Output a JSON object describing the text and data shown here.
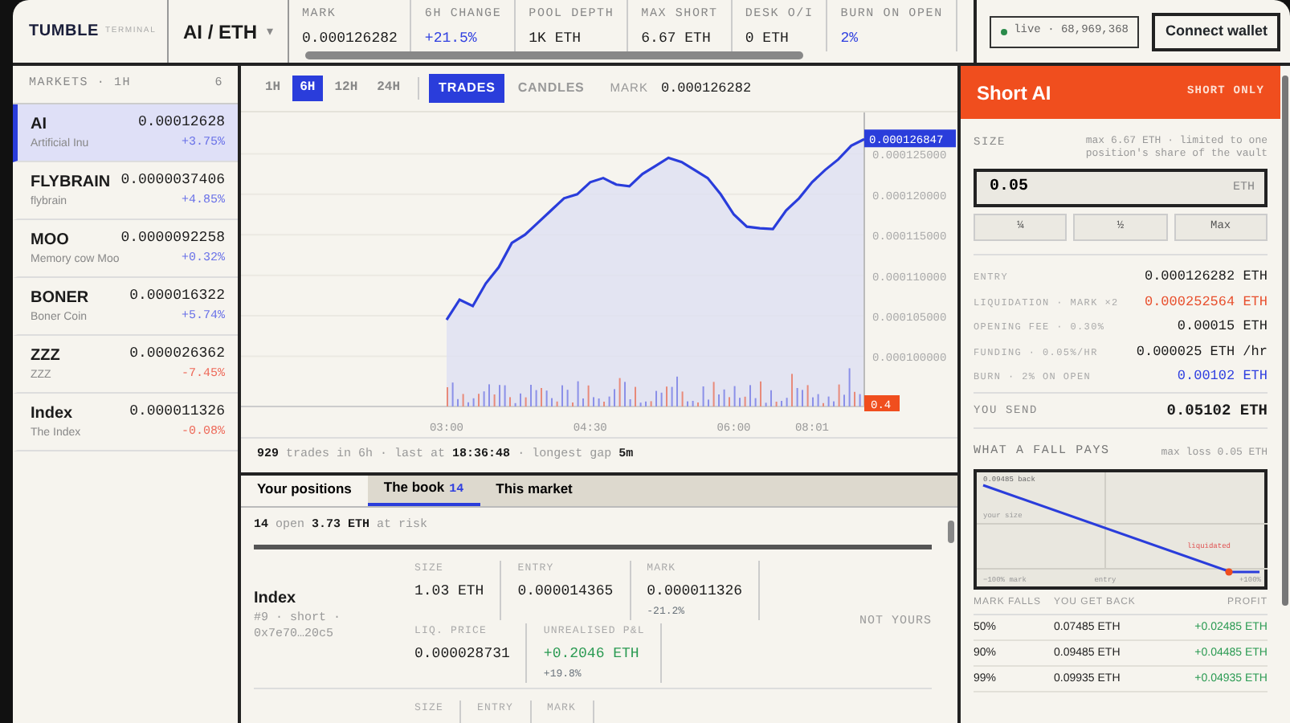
{
  "brand": {
    "name": "TUMBLE",
    "sub": "TERMINAL"
  },
  "pair": {
    "label": "AI / ETH",
    "caret": "▾"
  },
  "stats": [
    {
      "label": "MARK",
      "value": "0.000126282",
      "accent": false
    },
    {
      "label": "6H CHANGE",
      "value": "+21.5%",
      "accent": true
    },
    {
      "label": "POOL DEPTH",
      "value": "1K ETH",
      "accent": false
    },
    {
      "label": "MAX SHORT",
      "value": "6.67 ETH",
      "accent": false
    },
    {
      "label": "DESK O/I",
      "value": "0 ETH",
      "accent": false
    },
    {
      "label": "BURN ON OPEN",
      "value": "2%",
      "accent": true
    }
  ],
  "live": "live · 68,969,368",
  "connect_button": "Connect wallet",
  "markets": {
    "title": "MARKETS · 1H",
    "count": "6",
    "items": [
      {
        "symbol": "AI",
        "name": "Artificial Inu",
        "price": "0.00012628",
        "change": "+3.75%",
        "color": "#6a72e8",
        "selected": true
      },
      {
        "symbol": "FLYBRAIN",
        "name": "flybrain",
        "price": "0.0000037406",
        "change": "+4.85%",
        "color": "#6a72e8",
        "selected": false
      },
      {
        "symbol": "MOO",
        "name": "Memory cow Moo",
        "price": "0.0000092258",
        "change": "+0.32%",
        "color": "#6a72e8",
        "selected": false
      },
      {
        "symbol": "BONER",
        "name": "Boner Coin",
        "price": "0.000016322",
        "change": "+5.74%",
        "color": "#6a72e8",
        "selected": false
      },
      {
        "symbol": "ZZZ",
        "name": "ZZZ",
        "price": "0.000026362",
        "change": "-7.45%",
        "color": "#ee6a5a",
        "selected": false
      },
      {
        "symbol": "Index",
        "name": "The Index",
        "price": "0.000011326",
        "change": "-0.08%",
        "color": "#ee6a5a",
        "selected": false
      }
    ]
  },
  "timeframes": [
    {
      "label": "1H",
      "selected": false
    },
    {
      "label": "6H",
      "selected": true
    },
    {
      "label": "12H",
      "selected": false
    },
    {
      "label": "24H",
      "selected": false
    }
  ],
  "views": [
    {
      "label": "TRADES",
      "selected": true
    },
    {
      "label": "CANDLES",
      "selected": false
    }
  ],
  "mark": {
    "label": "MARK",
    "value": "0.000126282"
  },
  "chart": {
    "price_tag": "0.000126847",
    "volume_tag": "0.4",
    "chart_data": {
      "type": "area",
      "grid": true,
      "categories": [
        "03:00",
        null,
        null,
        null,
        null,
        null,
        null,
        null,
        null,
        null,
        null,
        "04:30",
        null,
        null,
        null,
        null,
        null,
        null,
        null,
        null,
        null,
        null,
        "06:00",
        null,
        null,
        null,
        null,
        null,
        "08:01",
        null,
        null,
        null,
        null
      ],
      "series": [
        {
          "color": "#2a3ddb",
          "values": [
            0.0001045,
            0.000107,
            0.0001062,
            0.000109,
            0.000111,
            0.000114,
            0.000115,
            0.0001165,
            0.000118,
            0.0001195,
            0.00012,
            0.0001215,
            0.000122,
            0.0001212,
            0.000121,
            0.0001225,
            0.0001235,
            0.0001245,
            0.000124,
            0.000123,
            0.000122,
            0.00012,
            0.0001175,
            0.000116,
            0.0001158,
            0.0001157,
            0.000118,
            0.0001195,
            0.0001215,
            0.000123,
            0.0001243,
            0.000126,
            0.0001268
          ]
        }
      ],
      "ylim": [
        9.38e-05,
        0.0001301
      ],
      "yticks": [
        {
          "value": 0.0001,
          "label": "0.000100000"
        },
        {
          "value": 0.000105,
          "label": "0.000105000"
        },
        {
          "value": 0.00011,
          "label": "0.000110000"
        },
        {
          "value": 0.000115,
          "label": "0.000115000"
        },
        {
          "value": 0.00012,
          "label": "0.000120000"
        },
        {
          "value": 0.000125,
          "label": "0.000125000"
        }
      ]
    }
  },
  "trade_info": "**929** trades in 6h · last at **18:36:48** · longest gap **5m**",
  "bottom_tabs": [
    {
      "label": "Your positions",
      "selected": false
    },
    {
      "label": "The book",
      "badge": "14",
      "selected": true
    },
    {
      "label": "This market",
      "selected": false
    }
  ],
  "book_summary": "**14** open  **3.73 ETH** at risk",
  "positions": [
    {
      "symbol": "Index",
      "meta": "#9 · short ·",
      "owner": "0x7e70…20c5",
      "status": "NOT YOURS",
      "cells": [
        {
          "label": "SIZE",
          "value": "1.03 ETH"
        },
        {
          "label": "ENTRY",
          "value": "0.000014365"
        },
        {
          "label": "MARK",
          "value": "0.000011326",
          "sub": "-21.2%"
        }
      ],
      "cells2": [
        {
          "label": "LIQ. PRICE",
          "value": "0.000028731"
        },
        {
          "label": "UNREALISED P&L",
          "value": "+0.2046 ETH",
          "sub": "+19.8%",
          "color": "#2a9a52"
        }
      ]
    },
    {
      "cells": [
        {
          "label": "SIZE"
        },
        {
          "label": "ENTRY"
        },
        {
          "label": "MARK"
        }
      ]
    }
  ],
  "order": {
    "title": "Short AI",
    "badge": "SHORT ONLY",
    "size_label": "SIZE",
    "size_hint": "max 6.67 ETH · limited to one position's share of the vault",
    "amount": "0.05",
    "unit": "ETH",
    "quick": [
      "¼",
      "½",
      "Max"
    ],
    "rows": [
      {
        "label": "ENTRY",
        "value": "0.000126282 ETH"
      },
      {
        "label": "LIQUIDATION · MARK ×2",
        "value": "0.000252564 ETH",
        "color": "#e8502e"
      },
      {
        "label": "OPENING FEE · 0.30%",
        "value": "0.00015 ETH"
      },
      {
        "label": "FUNDING · 0.05%/HR",
        "value": "0.000025 ETH /hr"
      },
      {
        "label": "BURN · 2% ON OPEN",
        "value": "0.00102 ETH",
        "color": "#3040e0"
      }
    ],
    "send": {
      "label": "YOU SEND",
      "value": "0.05102 ETH"
    }
  },
  "payoff": {
    "title": "WHAT A FALL PAYS",
    "note": "max loss 0.05 ETH",
    "top_label": "0.09485 back",
    "size_label": "your size",
    "liq_label": "liquidated",
    "axis": [
      "−100% mark",
      "entry",
      "+100%"
    ],
    "columns": [
      "MARK FALLS",
      "YOU GET BACK",
      "PROFIT"
    ],
    "rows": [
      [
        "50%",
        "0.07485 ETH",
        "+0.02485 ETH"
      ],
      [
        "90%",
        "0.09485 ETH",
        "+0.04485 ETH"
      ],
      [
        "99%",
        "0.09935 ETH",
        "+0.04935 ETH"
      ]
    ]
  }
}
